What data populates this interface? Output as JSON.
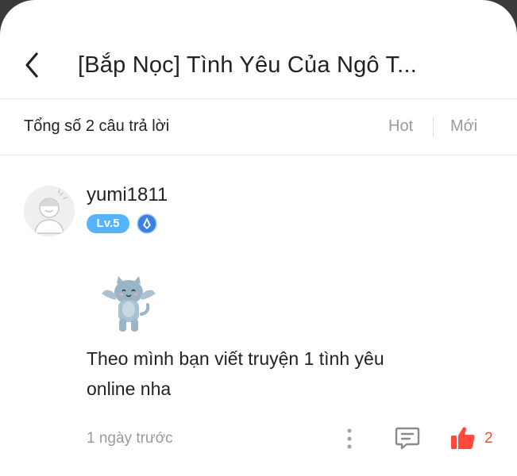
{
  "header": {
    "title": "[Bắp Nọc] Tình Yêu Của Ngô T..."
  },
  "summary": {
    "count_label": "Tổng số 2 câu trả lời",
    "sort_hot": "Hot",
    "sort_new": "Mới"
  },
  "answer": {
    "username": "yumi1811",
    "level": "Lv.5",
    "text": "Theo mình bạn viết truyện 1 tình yêu online nha",
    "time": "1 ngày trước",
    "like_count": "2"
  },
  "colors": {
    "accent_blue": "#56b3ff",
    "like_red": "#ff4a3d",
    "muted_text": "#9a9a9a"
  },
  "icons": [
    "back-arrow-icon",
    "medal-icon",
    "more-icon",
    "comment-icon",
    "thumbs-up-icon"
  ]
}
